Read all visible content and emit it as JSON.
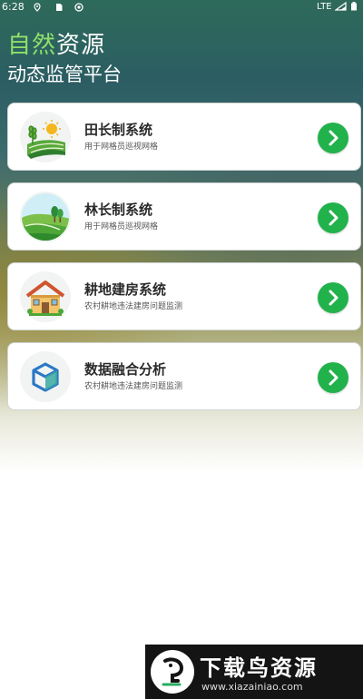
{
  "status_bar": {
    "time": "6:28",
    "network": "LTE"
  },
  "header": {
    "title_accent": "自然",
    "title_rest": "资源",
    "subtitle": "动态监管平台"
  },
  "cards": [
    {
      "title": "田长制系统",
      "subtitle": "用于网格员巡视网格",
      "icon": "farm-field-sun-icon"
    },
    {
      "title": "林长制系统",
      "subtitle": "用于网格员巡视网格",
      "icon": "forest-hills-icon"
    },
    {
      "title": "耕地建房系统",
      "subtitle": "农村耕地违法建房问题监测",
      "icon": "house-icon"
    },
    {
      "title": "数据融合分析",
      "subtitle": "农村耕地违法建房问题监测",
      "icon": "data-cube-icon"
    }
  ],
  "watermark": {
    "text": "下载鸟资源",
    "url": "www.xiazainiao.com"
  },
  "colors": {
    "accent_green": "#22b24c",
    "title_accent": "#8fe06a"
  }
}
